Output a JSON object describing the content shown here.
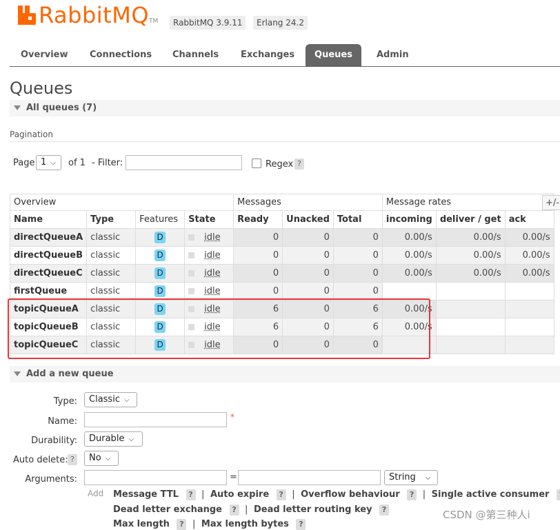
{
  "header": {
    "logo_text": "RabbitMQ",
    "tm": "TM",
    "versions": [
      "RabbitMQ 3.9.11",
      "Erlang 24.2"
    ],
    "brand_color": "#ff6600"
  },
  "nav": {
    "tabs": [
      "Overview",
      "Connections",
      "Channels",
      "Exchanges",
      "Queues",
      "Admin"
    ],
    "active": "Queues"
  },
  "page_title": "Queues",
  "all_queues_label": "All queues (7)",
  "pagination": {
    "label": "Pagination",
    "page_label": "Page",
    "page_value": "1",
    "of_label": "of 1",
    "filter_label": "- Filter:",
    "filter_value": "",
    "regex_label": "Regex",
    "help": "?"
  },
  "table": {
    "groups": [
      "Overview",
      "Messages",
      "Message rates"
    ],
    "plus_minus": "+/-",
    "columns": [
      "Name",
      "Type",
      "Features",
      "State",
      "Ready",
      "Unacked",
      "Total",
      "incoming",
      "deliver / get",
      "ack"
    ],
    "rows": [
      {
        "name": "directQueueA",
        "type": "classic",
        "feature": "D",
        "state": "idle",
        "ready": "0",
        "unacked": "0",
        "total": "0",
        "incoming": "0.00/s",
        "deliver": "0.00/s",
        "ack": "0.00/s"
      },
      {
        "name": "directQueueB",
        "type": "classic",
        "feature": "D",
        "state": "idle",
        "ready": "0",
        "unacked": "0",
        "total": "0",
        "incoming": "0.00/s",
        "deliver": "0.00/s",
        "ack": "0.00/s"
      },
      {
        "name": "directQueueC",
        "type": "classic",
        "feature": "D",
        "state": "idle",
        "ready": "0",
        "unacked": "0",
        "total": "0",
        "incoming": "0.00/s",
        "deliver": "0.00/s",
        "ack": "0.00/s"
      },
      {
        "name": "firstQueue",
        "type": "classic",
        "feature": "D",
        "state": "idle",
        "ready": "0",
        "unacked": "0",
        "total": "0",
        "incoming": "",
        "deliver": "",
        "ack": ""
      },
      {
        "name": "topicQueueA",
        "type": "classic",
        "feature": "D",
        "state": "idle",
        "ready": "6",
        "unacked": "0",
        "total": "6",
        "incoming": "0.00/s",
        "deliver": "",
        "ack": ""
      },
      {
        "name": "topicQueueB",
        "type": "classic",
        "feature": "D",
        "state": "idle",
        "ready": "6",
        "unacked": "0",
        "total": "6",
        "incoming": "0.00/s",
        "deliver": "",
        "ack": ""
      },
      {
        "name": "topicQueueC",
        "type": "classic",
        "feature": "D",
        "state": "idle",
        "ready": "0",
        "unacked": "0",
        "total": "0",
        "incoming": "",
        "deliver": "",
        "ack": ""
      }
    ]
  },
  "add_queue": {
    "title": "Add a new queue",
    "type_label": "Type:",
    "type_value": "Classic",
    "name_label": "Name:",
    "name_value": "",
    "required_mark": "*",
    "durability_label": "Durability:",
    "durability_value": "Durable",
    "auto_delete_label": "Auto delete:",
    "auto_delete_value": "No",
    "arguments_label": "Arguments:",
    "equals": "=",
    "arg_type_value": "String",
    "add_label": "Add",
    "arg_links_row1": [
      "Message TTL",
      "Auto expire",
      "Overflow behaviour",
      "Single active consumer"
    ],
    "arg_links_row2": [
      "Dead letter exchange",
      "Dead letter routing key"
    ],
    "arg_links_row3": [
      "Max length",
      "Max length bytes"
    ],
    "separator": "|"
  },
  "watermark": "CSDN @第三种人i"
}
